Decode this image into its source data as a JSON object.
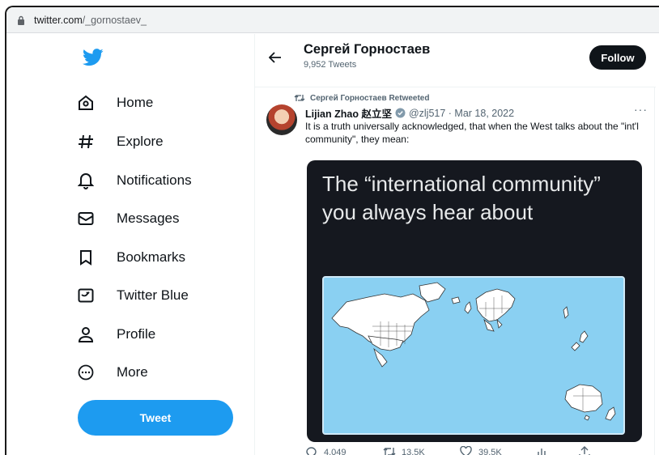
{
  "browser": {
    "domain": "twitter.com",
    "path": "/_gornostaev_"
  },
  "sidebar": {
    "items": [
      {
        "label": "Home",
        "icon": "home-icon"
      },
      {
        "label": "Explore",
        "icon": "hashtag-icon"
      },
      {
        "label": "Notifications",
        "icon": "bell-icon"
      },
      {
        "label": "Messages",
        "icon": "envelope-icon"
      },
      {
        "label": "Bookmarks",
        "icon": "bookmark-icon"
      },
      {
        "label": "Twitter Blue",
        "icon": "twitter-blue-icon"
      },
      {
        "label": "Profile",
        "icon": "person-icon"
      },
      {
        "label": "More",
        "icon": "more-circle-icon"
      }
    ],
    "tweet_label": "Tweet"
  },
  "header": {
    "name": "Сергей Горностаев",
    "tweet_count": "9,952 Tweets",
    "follow_label": "Follow"
  },
  "tweet": {
    "retweeted_by": "Сергей Горностаев Retweeted",
    "author_name": "Lijian Zhao 赵立坚",
    "handle_date": "@zlj517 · Mar 18, 2022",
    "more": "···",
    "text": "It is a truth universally acknowledged, that when the West talks about the \"int'l community\", they mean:",
    "image_caption": "The “international community” you always hear about",
    "replies": "4,049",
    "retweets": "13.5K",
    "likes": "39.5K"
  },
  "colors": {
    "accent": "#1d9bf0",
    "text": "#0f1419",
    "muted": "#536471",
    "map_water": "#8ad0f2"
  }
}
